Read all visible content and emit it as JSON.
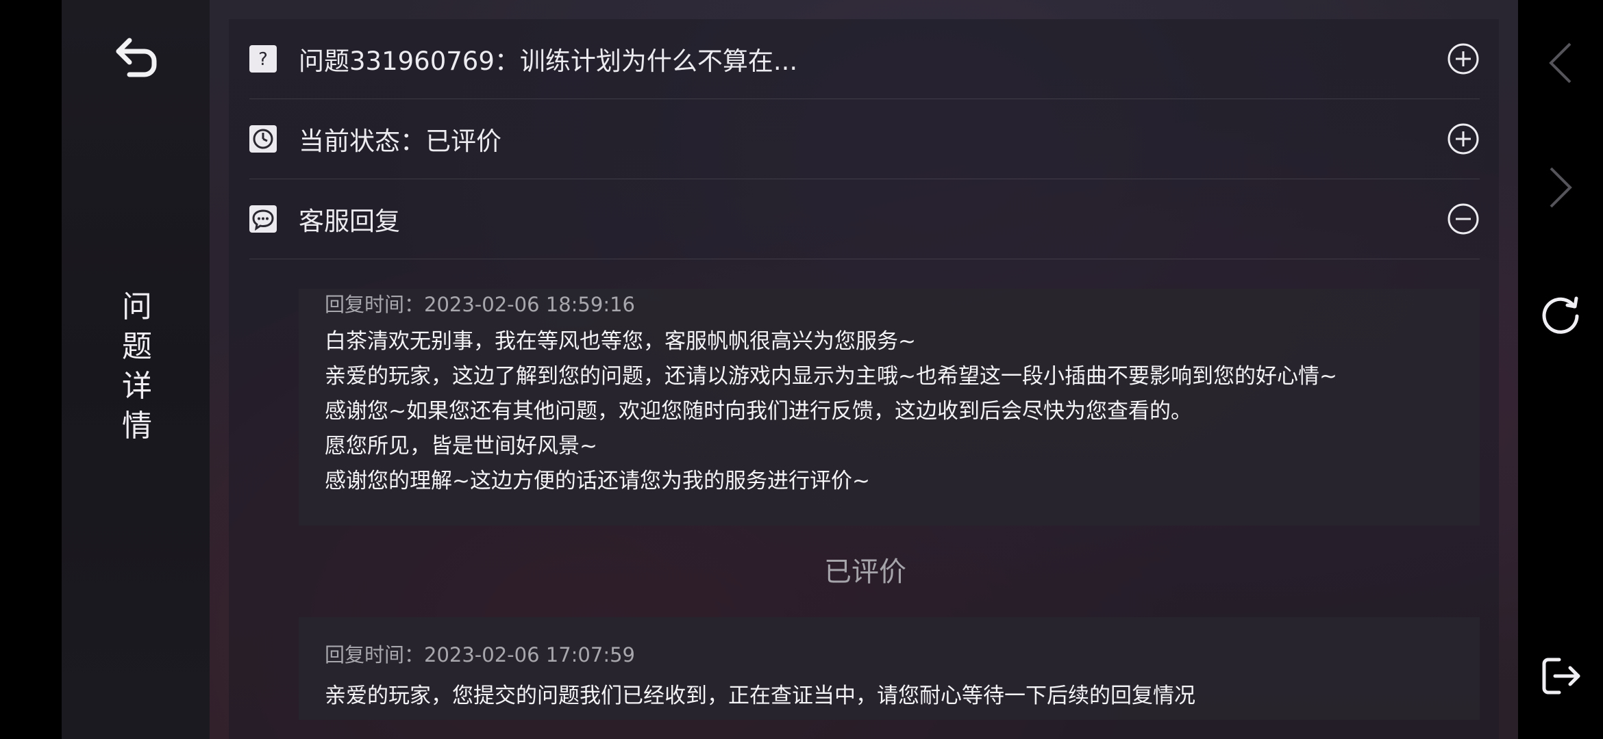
{
  "nav": {
    "back_icon": "back-arrow-icon",
    "title_chars": [
      "问",
      "题",
      "详",
      "情"
    ]
  },
  "rows": {
    "question": {
      "icon": "question-icon",
      "label": "问题331960769：训练计划为什么不算在...",
      "toggle": "plus-circle-icon"
    },
    "status": {
      "icon": "clock-icon",
      "label": "当前状态：已评价",
      "toggle": "plus-circle-icon"
    },
    "reply": {
      "icon": "chat-bubble-icon",
      "label": "客服回复",
      "toggle": "minus-circle-icon"
    }
  },
  "replies": [
    {
      "time": "回复时间：2023-02-06 18:59:16",
      "lines": [
        "白茶清欢无别事，我在等风也等您，客服帆帆很高兴为您服务~",
        "亲爱的玩家，这边了解到您的问题，还请以游戏内显示为主哦~也希望这一段小插曲不要影响到您的好心情~",
        "感谢您~如果您还有其他问题，欢迎您随时向我们进行反馈，这边收到后会尽快为您查看的。",
        "愿您所见，皆是世间好风景~",
        "感谢您的理解~这边方便的话还请您为我的服务进行评价~"
      ]
    },
    {
      "time": "回复时间：2023-02-06 17:07:59",
      "lines": [
        "亲爱的玩家，您提交的问题我们已经收到，正在查证当中，请您耐心等待一下后续的回复情况"
      ]
    }
  ],
  "rated_label": "已评价",
  "side_buttons": [
    "chevron-left-icon",
    "chevron-right-icon",
    "refresh-icon",
    "exit-icon"
  ],
  "colors": {
    "accent_text": "#ecebef",
    "muted_text": "#a9a7ae",
    "icon_bg": "#eceaee"
  }
}
